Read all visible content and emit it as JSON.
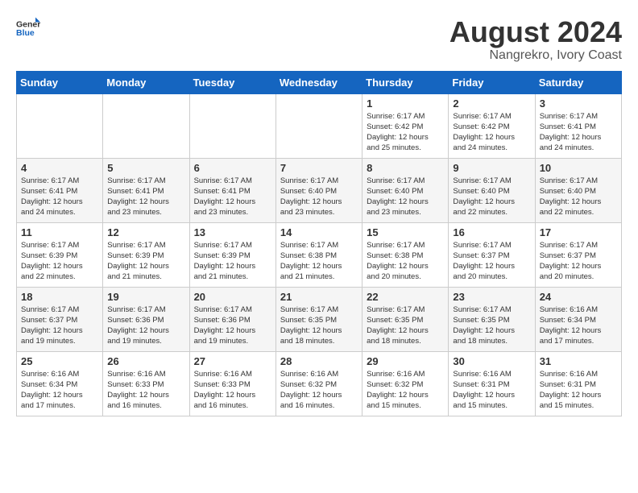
{
  "logo": {
    "general": "General",
    "blue": "Blue"
  },
  "title": {
    "month_year": "August 2024",
    "location": "Nangrekro, Ivory Coast"
  },
  "weekdays": [
    "Sunday",
    "Monday",
    "Tuesday",
    "Wednesday",
    "Thursday",
    "Friday",
    "Saturday"
  ],
  "weeks": [
    [
      {
        "day": "",
        "info": ""
      },
      {
        "day": "",
        "info": ""
      },
      {
        "day": "",
        "info": ""
      },
      {
        "day": "",
        "info": ""
      },
      {
        "day": "1",
        "info": "Sunrise: 6:17 AM\nSunset: 6:42 PM\nDaylight: 12 hours\nand 25 minutes."
      },
      {
        "day": "2",
        "info": "Sunrise: 6:17 AM\nSunset: 6:42 PM\nDaylight: 12 hours\nand 24 minutes."
      },
      {
        "day": "3",
        "info": "Sunrise: 6:17 AM\nSunset: 6:41 PM\nDaylight: 12 hours\nand 24 minutes."
      }
    ],
    [
      {
        "day": "4",
        "info": "Sunrise: 6:17 AM\nSunset: 6:41 PM\nDaylight: 12 hours\nand 24 minutes."
      },
      {
        "day": "5",
        "info": "Sunrise: 6:17 AM\nSunset: 6:41 PM\nDaylight: 12 hours\nand 23 minutes."
      },
      {
        "day": "6",
        "info": "Sunrise: 6:17 AM\nSunset: 6:41 PM\nDaylight: 12 hours\nand 23 minutes."
      },
      {
        "day": "7",
        "info": "Sunrise: 6:17 AM\nSunset: 6:40 PM\nDaylight: 12 hours\nand 23 minutes."
      },
      {
        "day": "8",
        "info": "Sunrise: 6:17 AM\nSunset: 6:40 PM\nDaylight: 12 hours\nand 23 minutes."
      },
      {
        "day": "9",
        "info": "Sunrise: 6:17 AM\nSunset: 6:40 PM\nDaylight: 12 hours\nand 22 minutes."
      },
      {
        "day": "10",
        "info": "Sunrise: 6:17 AM\nSunset: 6:40 PM\nDaylight: 12 hours\nand 22 minutes."
      }
    ],
    [
      {
        "day": "11",
        "info": "Sunrise: 6:17 AM\nSunset: 6:39 PM\nDaylight: 12 hours\nand 22 minutes."
      },
      {
        "day": "12",
        "info": "Sunrise: 6:17 AM\nSunset: 6:39 PM\nDaylight: 12 hours\nand 21 minutes."
      },
      {
        "day": "13",
        "info": "Sunrise: 6:17 AM\nSunset: 6:39 PM\nDaylight: 12 hours\nand 21 minutes."
      },
      {
        "day": "14",
        "info": "Sunrise: 6:17 AM\nSunset: 6:38 PM\nDaylight: 12 hours\nand 21 minutes."
      },
      {
        "day": "15",
        "info": "Sunrise: 6:17 AM\nSunset: 6:38 PM\nDaylight: 12 hours\nand 20 minutes."
      },
      {
        "day": "16",
        "info": "Sunrise: 6:17 AM\nSunset: 6:37 PM\nDaylight: 12 hours\nand 20 minutes."
      },
      {
        "day": "17",
        "info": "Sunrise: 6:17 AM\nSunset: 6:37 PM\nDaylight: 12 hours\nand 20 minutes."
      }
    ],
    [
      {
        "day": "18",
        "info": "Sunrise: 6:17 AM\nSunset: 6:37 PM\nDaylight: 12 hours\nand 19 minutes."
      },
      {
        "day": "19",
        "info": "Sunrise: 6:17 AM\nSunset: 6:36 PM\nDaylight: 12 hours\nand 19 minutes."
      },
      {
        "day": "20",
        "info": "Sunrise: 6:17 AM\nSunset: 6:36 PM\nDaylight: 12 hours\nand 19 minutes."
      },
      {
        "day": "21",
        "info": "Sunrise: 6:17 AM\nSunset: 6:35 PM\nDaylight: 12 hours\nand 18 minutes."
      },
      {
        "day": "22",
        "info": "Sunrise: 6:17 AM\nSunset: 6:35 PM\nDaylight: 12 hours\nand 18 minutes."
      },
      {
        "day": "23",
        "info": "Sunrise: 6:17 AM\nSunset: 6:35 PM\nDaylight: 12 hours\nand 18 minutes."
      },
      {
        "day": "24",
        "info": "Sunrise: 6:16 AM\nSunset: 6:34 PM\nDaylight: 12 hours\nand 17 minutes."
      }
    ],
    [
      {
        "day": "25",
        "info": "Sunrise: 6:16 AM\nSunset: 6:34 PM\nDaylight: 12 hours\nand 17 minutes."
      },
      {
        "day": "26",
        "info": "Sunrise: 6:16 AM\nSunset: 6:33 PM\nDaylight: 12 hours\nand 16 minutes."
      },
      {
        "day": "27",
        "info": "Sunrise: 6:16 AM\nSunset: 6:33 PM\nDaylight: 12 hours\nand 16 minutes."
      },
      {
        "day": "28",
        "info": "Sunrise: 6:16 AM\nSunset: 6:32 PM\nDaylight: 12 hours\nand 16 minutes."
      },
      {
        "day": "29",
        "info": "Sunrise: 6:16 AM\nSunset: 6:32 PM\nDaylight: 12 hours\nand 15 minutes."
      },
      {
        "day": "30",
        "info": "Sunrise: 6:16 AM\nSunset: 6:31 PM\nDaylight: 12 hours\nand 15 minutes."
      },
      {
        "day": "31",
        "info": "Sunrise: 6:16 AM\nSunset: 6:31 PM\nDaylight: 12 hours\nand 15 minutes."
      }
    ]
  ]
}
